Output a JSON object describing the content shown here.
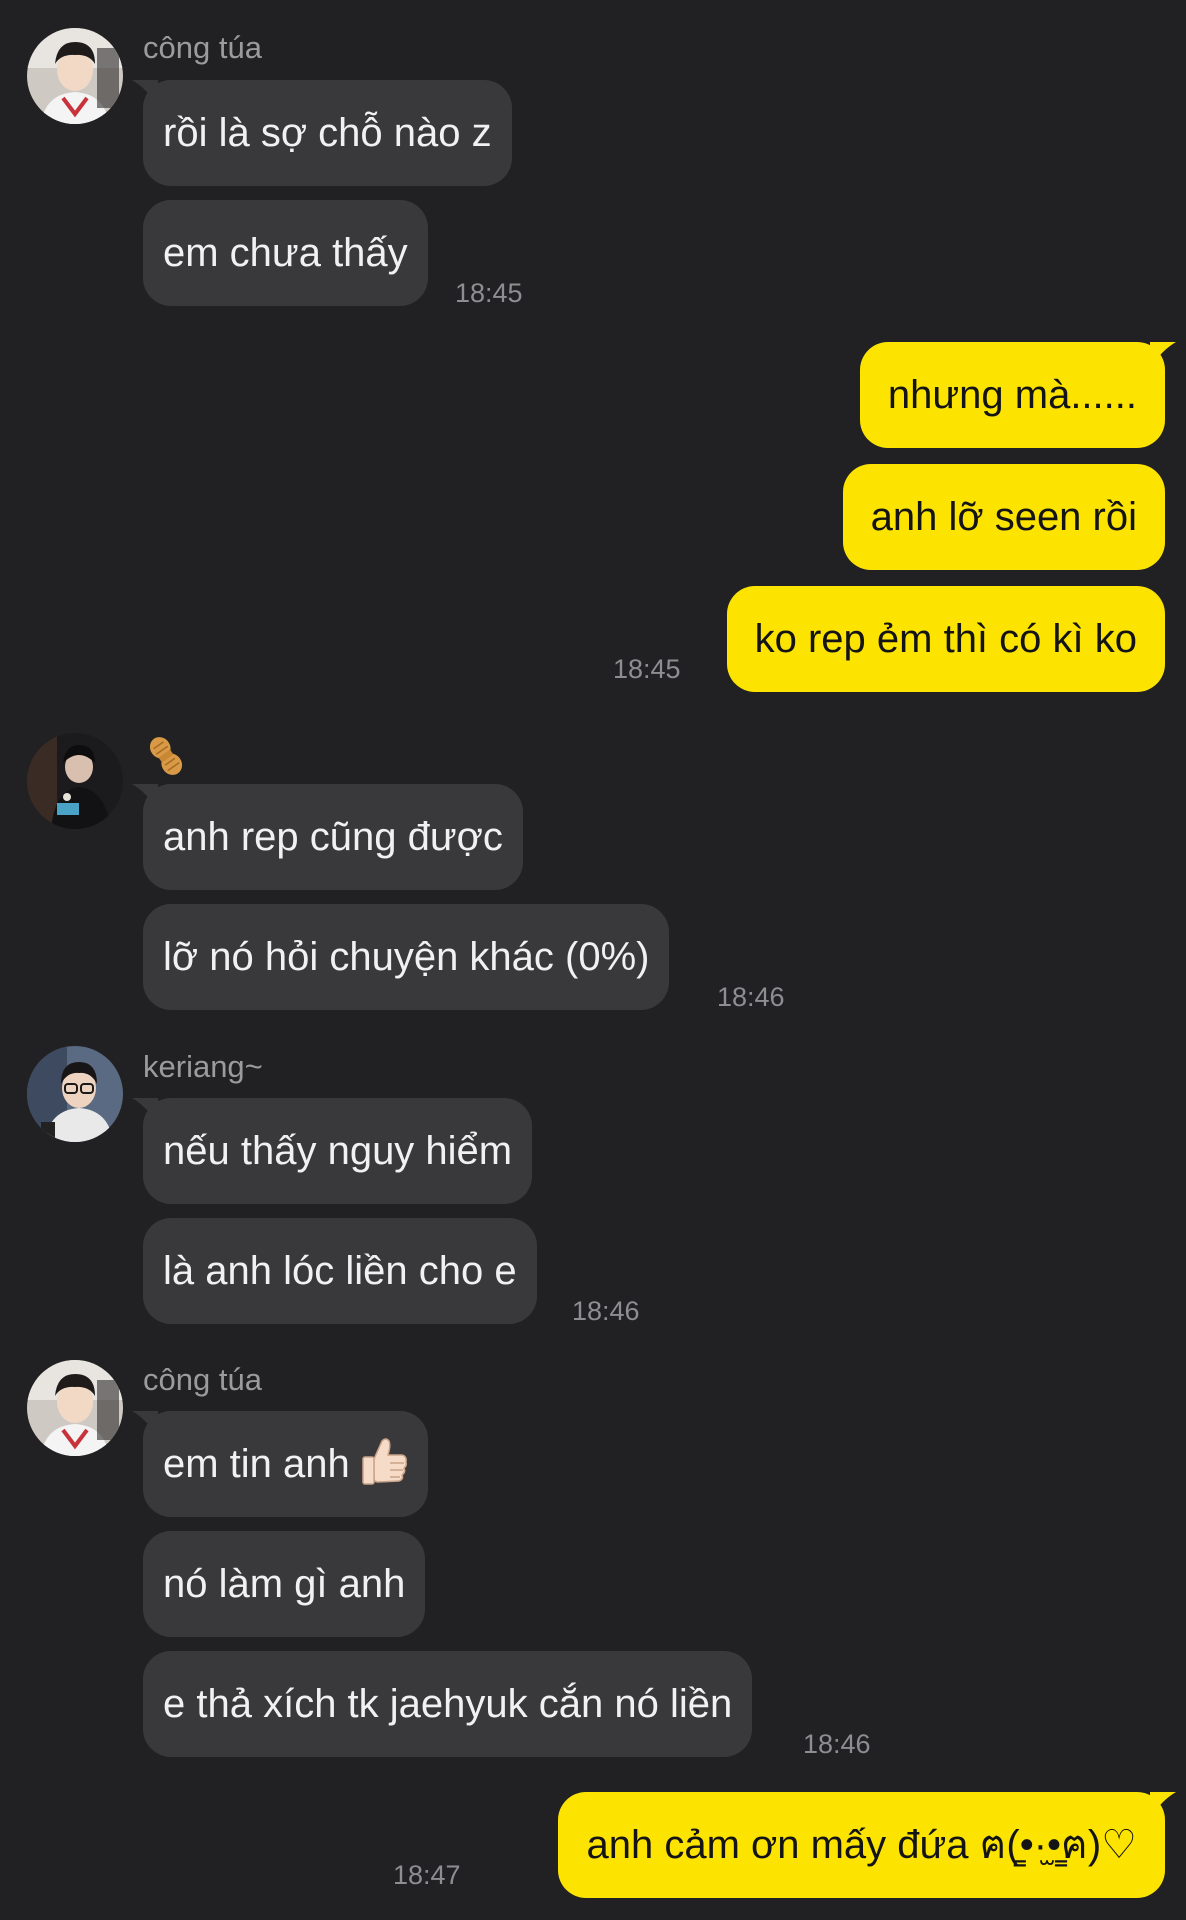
{
  "chat": {
    "colors": {
      "background": "#212123",
      "incoming_bubble": "#39393c",
      "outgoing_bubble": "#fde400",
      "sender_name": "#9b9b9e",
      "timestamp": "#8e8e92"
    },
    "groups": [
      {
        "direction": "in",
        "sender": "công túa",
        "avatar_icon": "avatar-photo-1",
        "messages": [
          "rồi là sợ chỗ nào z",
          "em chưa thấy"
        ],
        "time": "18:45"
      },
      {
        "direction": "out",
        "messages": [
          "nhưng mà......",
          "anh lỡ seen rồi",
          "ko rep ẻm thì có kì ko"
        ],
        "time": "18:45"
      },
      {
        "direction": "in",
        "sender_icon": "peanut-sticker-icon",
        "avatar_icon": "avatar-photo-2",
        "messages": [
          "anh rep cũng được",
          "lỡ nó hỏi chuyện khác (0%)"
        ],
        "time": "18:46"
      },
      {
        "direction": "in",
        "sender": "keriang~",
        "avatar_icon": "avatar-photo-3",
        "messages": [
          "nếu thấy nguy hiểm",
          "là anh lóc liền cho e"
        ],
        "time": "18:46"
      },
      {
        "direction": "in",
        "sender": "công túa",
        "avatar_icon": "avatar-photo-1",
        "messages": [
          "em tin anh",
          "nó làm gì anh",
          "e thả xích tk jaehyuk cắn nó liền"
        ],
        "message_icons": {
          "0": "thumbs-up-icon"
        },
        "time": "18:46"
      },
      {
        "direction": "out",
        "messages": [
          "anh cảm ơn mấy đứa ฅ(̳•·̫•̳ฅ)♡"
        ],
        "time": "18:47"
      }
    ]
  }
}
